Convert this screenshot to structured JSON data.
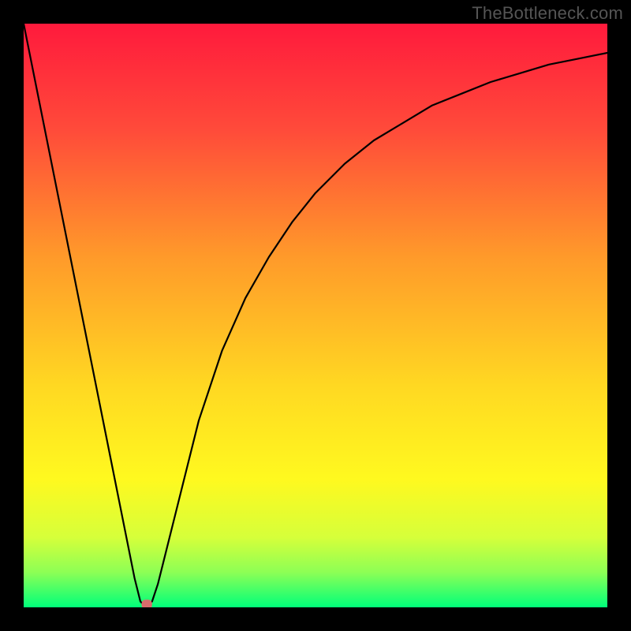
{
  "watermark": "TheBottleneck.com",
  "gradient": {
    "stops": [
      {
        "offset": 0.0,
        "color": "#ff1a3c"
      },
      {
        "offset": 0.18,
        "color": "#ff4a3a"
      },
      {
        "offset": 0.4,
        "color": "#ff9a2a"
      },
      {
        "offset": 0.62,
        "color": "#ffd822"
      },
      {
        "offset": 0.78,
        "color": "#fff91f"
      },
      {
        "offset": 0.88,
        "color": "#d6ff3a"
      },
      {
        "offset": 0.94,
        "color": "#8dff55"
      },
      {
        "offset": 1.0,
        "color": "#00ff7a"
      }
    ]
  },
  "chart_data": {
    "type": "line",
    "title": "",
    "xlabel": "",
    "ylabel": "",
    "xlim": [
      0,
      100
    ],
    "ylim": [
      0,
      100
    ],
    "grid": false,
    "legend": false,
    "x": [
      0,
      2,
      4,
      6,
      8,
      10,
      12,
      14,
      16,
      18,
      19,
      20,
      21,
      22,
      23,
      24,
      26,
      28,
      30,
      34,
      38,
      42,
      46,
      50,
      55,
      60,
      65,
      70,
      75,
      80,
      85,
      90,
      95,
      100
    ],
    "values": [
      100,
      90,
      80,
      70,
      60,
      50,
      40,
      30,
      20,
      10,
      5,
      1,
      0,
      1,
      4,
      8,
      16,
      24,
      32,
      44,
      53,
      60,
      66,
      71,
      76,
      80,
      83,
      86,
      88,
      90,
      91.5,
      93,
      94,
      95
    ],
    "marker": {
      "x_start": 20.2,
      "x_end": 22.0,
      "y": 0.5
    }
  }
}
